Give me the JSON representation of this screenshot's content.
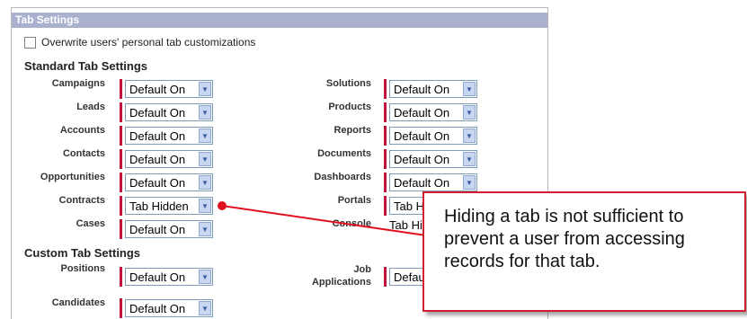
{
  "panel": {
    "title": "Tab Settings",
    "overwrite_label": "Overwrite users' personal tab customizations",
    "overwrite_checked": false
  },
  "standard": {
    "title": "Standard Tab Settings",
    "left": [
      {
        "label": "Campaigns",
        "value": "Default On"
      },
      {
        "label": "Leads",
        "value": "Default On"
      },
      {
        "label": "Accounts",
        "value": "Default On"
      },
      {
        "label": "Contacts",
        "value": "Default On"
      },
      {
        "label": "Opportunities",
        "value": "Default On"
      },
      {
        "label": "Contracts",
        "value": "Tab Hidden"
      },
      {
        "label": "Cases",
        "value": "Default On"
      }
    ],
    "right": [
      {
        "label": "Solutions",
        "value": "Default On"
      },
      {
        "label": "Products",
        "value": "Default On"
      },
      {
        "label": "Reports",
        "value": "Default On"
      },
      {
        "label": "Documents",
        "value": "Default On"
      },
      {
        "label": "Dashboards",
        "value": "Default On"
      },
      {
        "label": "Portals",
        "value": "Tab Hidden"
      },
      {
        "label": "Console",
        "value": "Tab Hidden"
      }
    ]
  },
  "custom": {
    "title": "Custom Tab Settings",
    "left": [
      {
        "label": "Positions",
        "value": "Default On"
      },
      {
        "label": "Candidates",
        "value": "Default On"
      }
    ],
    "right": [
      {
        "label_line1": "Job",
        "label_line2": "Applications",
        "value": "Default On"
      }
    ]
  },
  "callout": {
    "text": "Hiding a tab is not sufficient to prevent a user from accessing records for that tab."
  },
  "colors": {
    "header_bg": "#a9b1cf",
    "required_bar": "#c0143c",
    "callout_border": "#d02030",
    "callout_line": "#e0101e"
  }
}
